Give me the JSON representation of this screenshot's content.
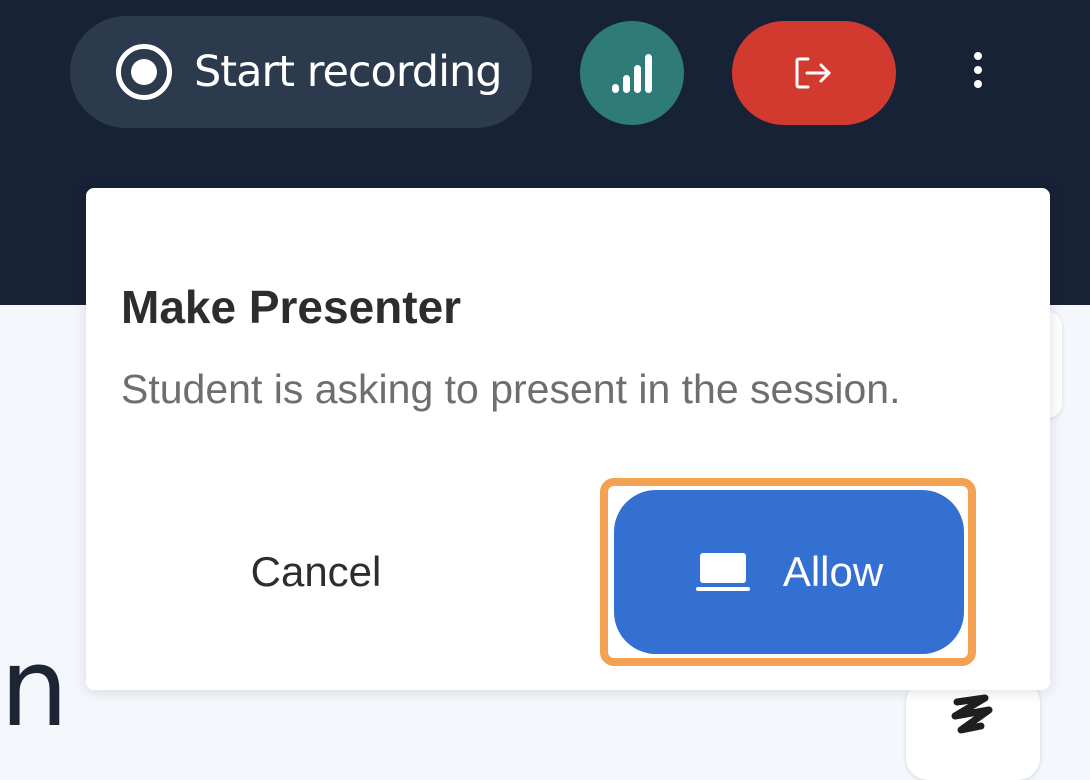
{
  "header": {
    "record_button": {
      "label": "Start recording",
      "icon": "record-icon"
    },
    "signal_button": {
      "icon": "signal-bars-icon",
      "color": "#2f7b78"
    },
    "leave_button": {
      "icon": "exit-icon",
      "color": "#d23a2f"
    },
    "more_button": {
      "icon": "kebab-menu-icon"
    }
  },
  "background": {
    "partial_text": "n",
    "tool_icon": "scribble-icon"
  },
  "dialog": {
    "title": "Make Presenter",
    "message": "Student is asking to present in the session.",
    "cancel_label": "Cancel",
    "allow_label": "Allow",
    "allow_icon": "laptop-icon",
    "allow_color": "#3470d2",
    "focus_color": "#f2a251"
  }
}
